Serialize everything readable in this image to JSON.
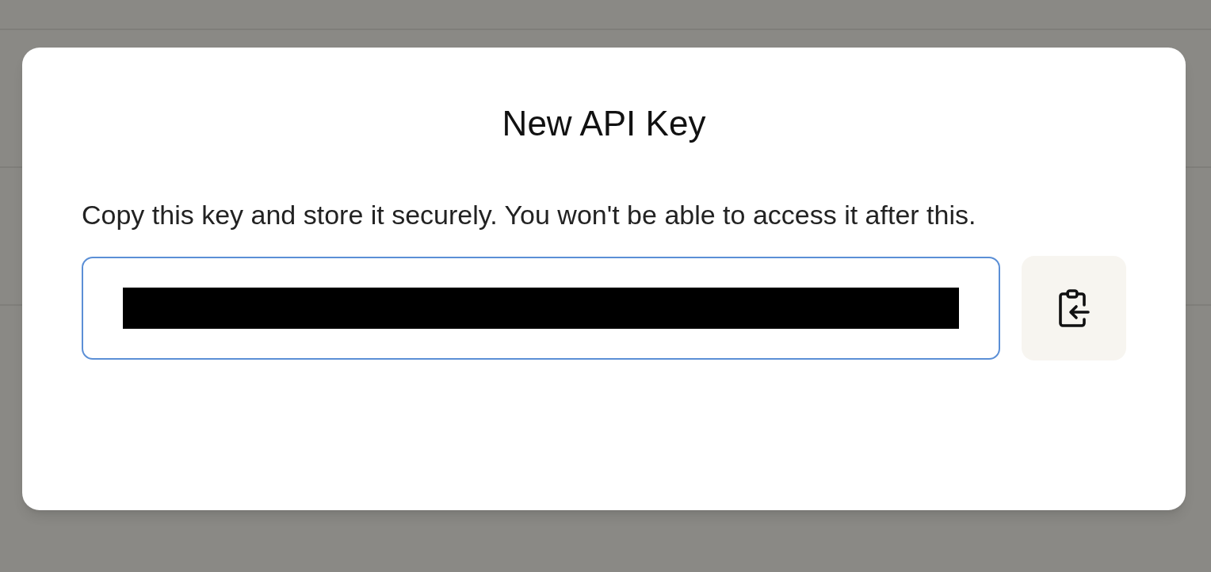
{
  "dialog": {
    "title": "New API Key",
    "message": "Copy this key and store it securely. You won't be able to access it after this.",
    "key_field": {
      "redacted": true,
      "focused": true
    },
    "copy_button": {
      "kind": "clipboard"
    }
  }
}
